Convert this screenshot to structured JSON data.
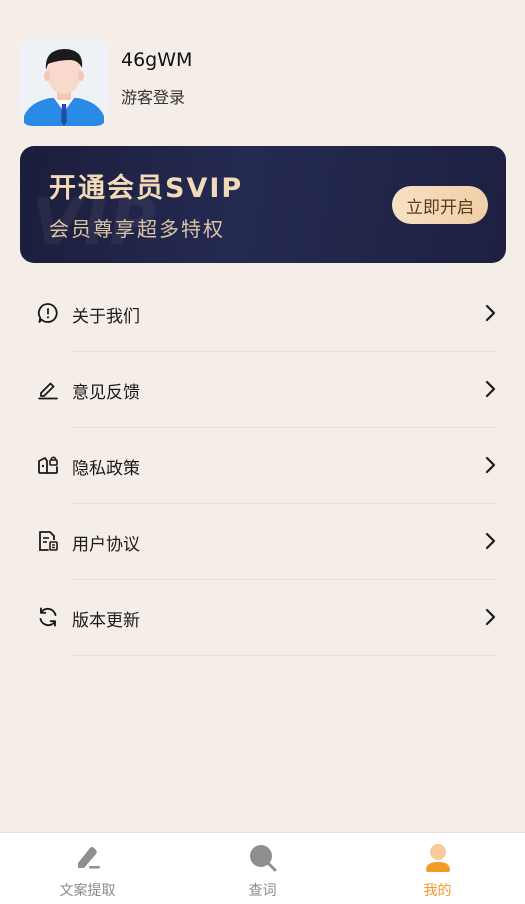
{
  "profile": {
    "username": "46gWM",
    "login_status": "游客登录",
    "avatar_icon": "user-avatar-icon"
  },
  "vip_banner": {
    "title": "开通会员SVIP",
    "subtitle": "会员尊享超多特权",
    "watermark": "VIP",
    "button_label": "立即开启"
  },
  "menu": {
    "items": [
      {
        "label": "关于我们",
        "icon": "info-circle-icon"
      },
      {
        "label": "意见反馈",
        "icon": "pencil-edit-icon"
      },
      {
        "label": "隐私政策",
        "icon": "privacy-lock-icon"
      },
      {
        "label": "用户协议",
        "icon": "document-icon"
      },
      {
        "label": "版本更新",
        "icon": "refresh-icon"
      }
    ]
  },
  "bottom_nav": {
    "items": [
      {
        "label": "文案提取",
        "icon": "pen-icon",
        "active": false
      },
      {
        "label": "查词",
        "icon": "search-icon",
        "active": false
      },
      {
        "label": "我的",
        "icon": "user-icon",
        "active": true
      }
    ]
  },
  "colors": {
    "background": "#f5eee8",
    "accent": "#f39a2b",
    "vip_dark": "#1b1d3a",
    "vip_gold": "#f2d9b8"
  }
}
